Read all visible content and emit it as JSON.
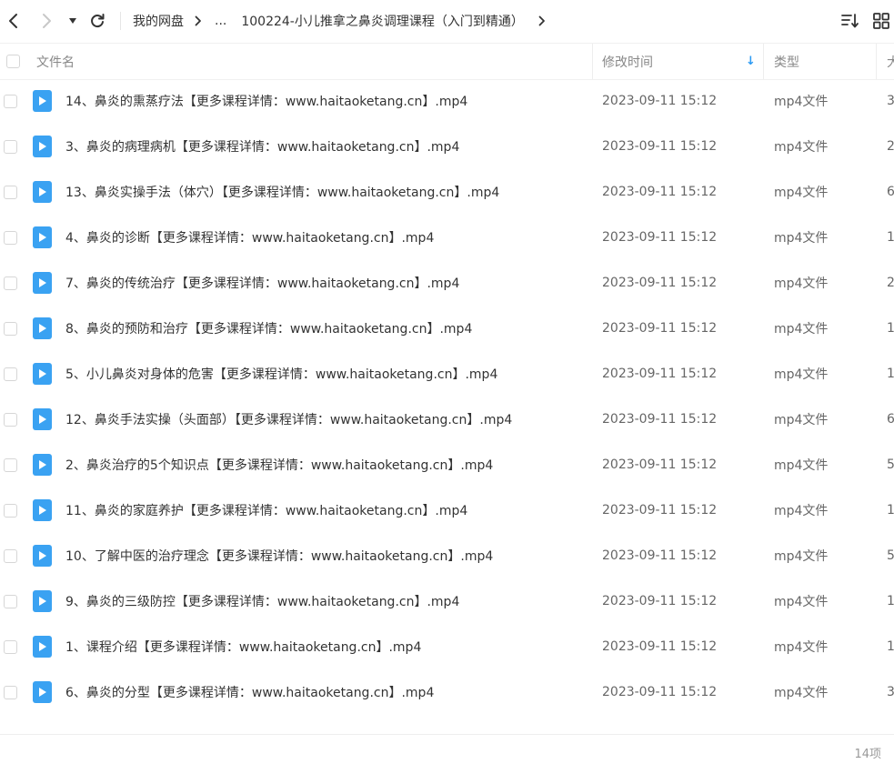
{
  "toolbar": {
    "breadcrumb_root": "我的网盘",
    "breadcrumb_ellipsis": "...",
    "breadcrumb_current": "100224-小儿推拿之鼻炎调理课程（入门到精通）"
  },
  "table": {
    "columns": {
      "name": "文件名",
      "modified": "修改时间",
      "type": "类型",
      "size": "大小"
    },
    "sort_indicator": "↓",
    "rows": [
      {
        "name": "14、鼻炎的熏蒸疗法【更多课程详情：www.haitaoketang.cn】.mp4",
        "modified": "2023-09-11 15:12",
        "type": "mp4文件",
        "size": "3"
      },
      {
        "name": "3、鼻炎的病理病机【更多课程详情：www.haitaoketang.cn】.mp4",
        "modified": "2023-09-11 15:12",
        "type": "mp4文件",
        "size": "2"
      },
      {
        "name": "13、鼻炎实操手法（体穴）【更多课程详情：www.haitaoketang.cn】.mp4",
        "modified": "2023-09-11 15:12",
        "type": "mp4文件",
        "size": "6"
      },
      {
        "name": "4、鼻炎的诊断【更多课程详情：www.haitaoketang.cn】.mp4",
        "modified": "2023-09-11 15:12",
        "type": "mp4文件",
        "size": "1"
      },
      {
        "name": "7、鼻炎的传统治疗【更多课程详情：www.haitaoketang.cn】.mp4",
        "modified": "2023-09-11 15:12",
        "type": "mp4文件",
        "size": "2"
      },
      {
        "name": "8、鼻炎的预防和治疗【更多课程详情：www.haitaoketang.cn】.mp4",
        "modified": "2023-09-11 15:12",
        "type": "mp4文件",
        "size": "1"
      },
      {
        "name": "5、小儿鼻炎对身体的危害【更多课程详情：www.haitaoketang.cn】.mp4",
        "modified": "2023-09-11 15:12",
        "type": "mp4文件",
        "size": "1"
      },
      {
        "name": "12、鼻炎手法实操（头面部）【更多课程详情：www.haitaoketang.cn】.mp4",
        "modified": "2023-09-11 15:12",
        "type": "mp4文件",
        "size": "6"
      },
      {
        "name": "2、鼻炎治疗的5个知识点【更多课程详情：www.haitaoketang.cn】.mp4",
        "modified": "2023-09-11 15:12",
        "type": "mp4文件",
        "size": "5"
      },
      {
        "name": "11、鼻炎的家庭养护【更多课程详情：www.haitaoketang.cn】.mp4",
        "modified": "2023-09-11 15:12",
        "type": "mp4文件",
        "size": "1"
      },
      {
        "name": "10、了解中医的治疗理念【更多课程详情：www.haitaoketang.cn】.mp4",
        "modified": "2023-09-11 15:12",
        "type": "mp4文件",
        "size": "5"
      },
      {
        "name": "9、鼻炎的三级防控【更多课程详情：www.haitaoketang.cn】.mp4",
        "modified": "2023-09-11 15:12",
        "type": "mp4文件",
        "size": "1"
      },
      {
        "name": "1、课程介绍【更多课程详情：www.haitaoketang.cn】.mp4",
        "modified": "2023-09-11 15:12",
        "type": "mp4文件",
        "size": "1"
      },
      {
        "name": "6、鼻炎的分型【更多课程详情：www.haitaoketang.cn】.mp4",
        "modified": "2023-09-11 15:12",
        "type": "mp4文件",
        "size": "3"
      }
    ]
  },
  "footer": {
    "count": "14项"
  },
  "icons": {
    "back": "back-arrow-icon",
    "forward": "forward-arrow-icon",
    "history": "dropdown-triangle-icon",
    "refresh": "refresh-icon",
    "sort": "sort-icon",
    "grid": "grid-view-icon",
    "file": "video-file-icon"
  },
  "colors": {
    "accent": "#2b9af3",
    "file_icon": "#3aa2f2",
    "disabled": "#c8c8c8"
  }
}
